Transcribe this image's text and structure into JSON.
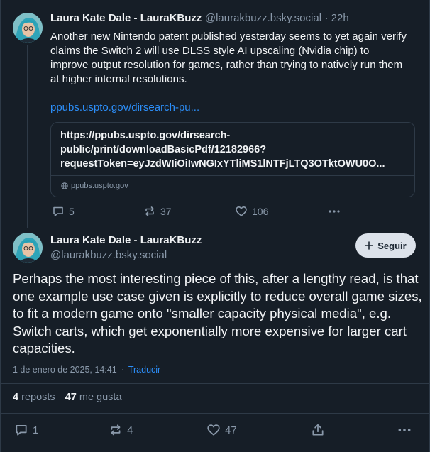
{
  "parent_post": {
    "display_name": "Laura Kate Dale - LauraKBuzz",
    "handle": "@laurakbuzz.bsky.social",
    "time": "· 22h",
    "text": "Another new Nintendo patent published yesterday seems to yet again verify claims the Switch 2 will use DLSS style AI upscaling (Nvidia chip) to improve output resolution for games, rather than trying to natively run them at higher internal resolutions.",
    "link_text": "ppubs.uspto.gov/dirsearch-pu...",
    "card": {
      "line1": "https://ppubs.uspto.gov/dirsearch-",
      "line2": "public/print/downloadBasicPdf/12182966?",
      "line3": "requestToken=eyJzdWIiOiIwNGIxYTliMS1lNTFjLTQ3OTktOWU0O...",
      "domain": "ppubs.uspto.gov"
    },
    "replies": "5",
    "reposts": "37",
    "likes": "106"
  },
  "main_post": {
    "display_name": "Laura Kate Dale - LauraKBuzz",
    "handle": "@laurakbuzz.bsky.social",
    "follow_label": "Seguir",
    "text": "Perhaps the most interesting piece of this, after a lengthy read, is that one example use case given is explicitly to reduce overall game sizes, to fit a modern game onto \"smaller capacity physical media\", e.g. Switch carts, which get exponentially more expensive for larger cart capacities.",
    "date": "1 de enero de 2025, 14:41",
    "translate_label": "Traducir",
    "reposts_count": "4",
    "reposts_label": "reposts",
    "likes_count": "47",
    "likes_label": "me gusta",
    "replies": "1",
    "reposts": "4",
    "likes": "47"
  },
  "colors": {
    "background": "#161e27",
    "accent": "#2c8ef8",
    "muted": "#8a99aa"
  }
}
